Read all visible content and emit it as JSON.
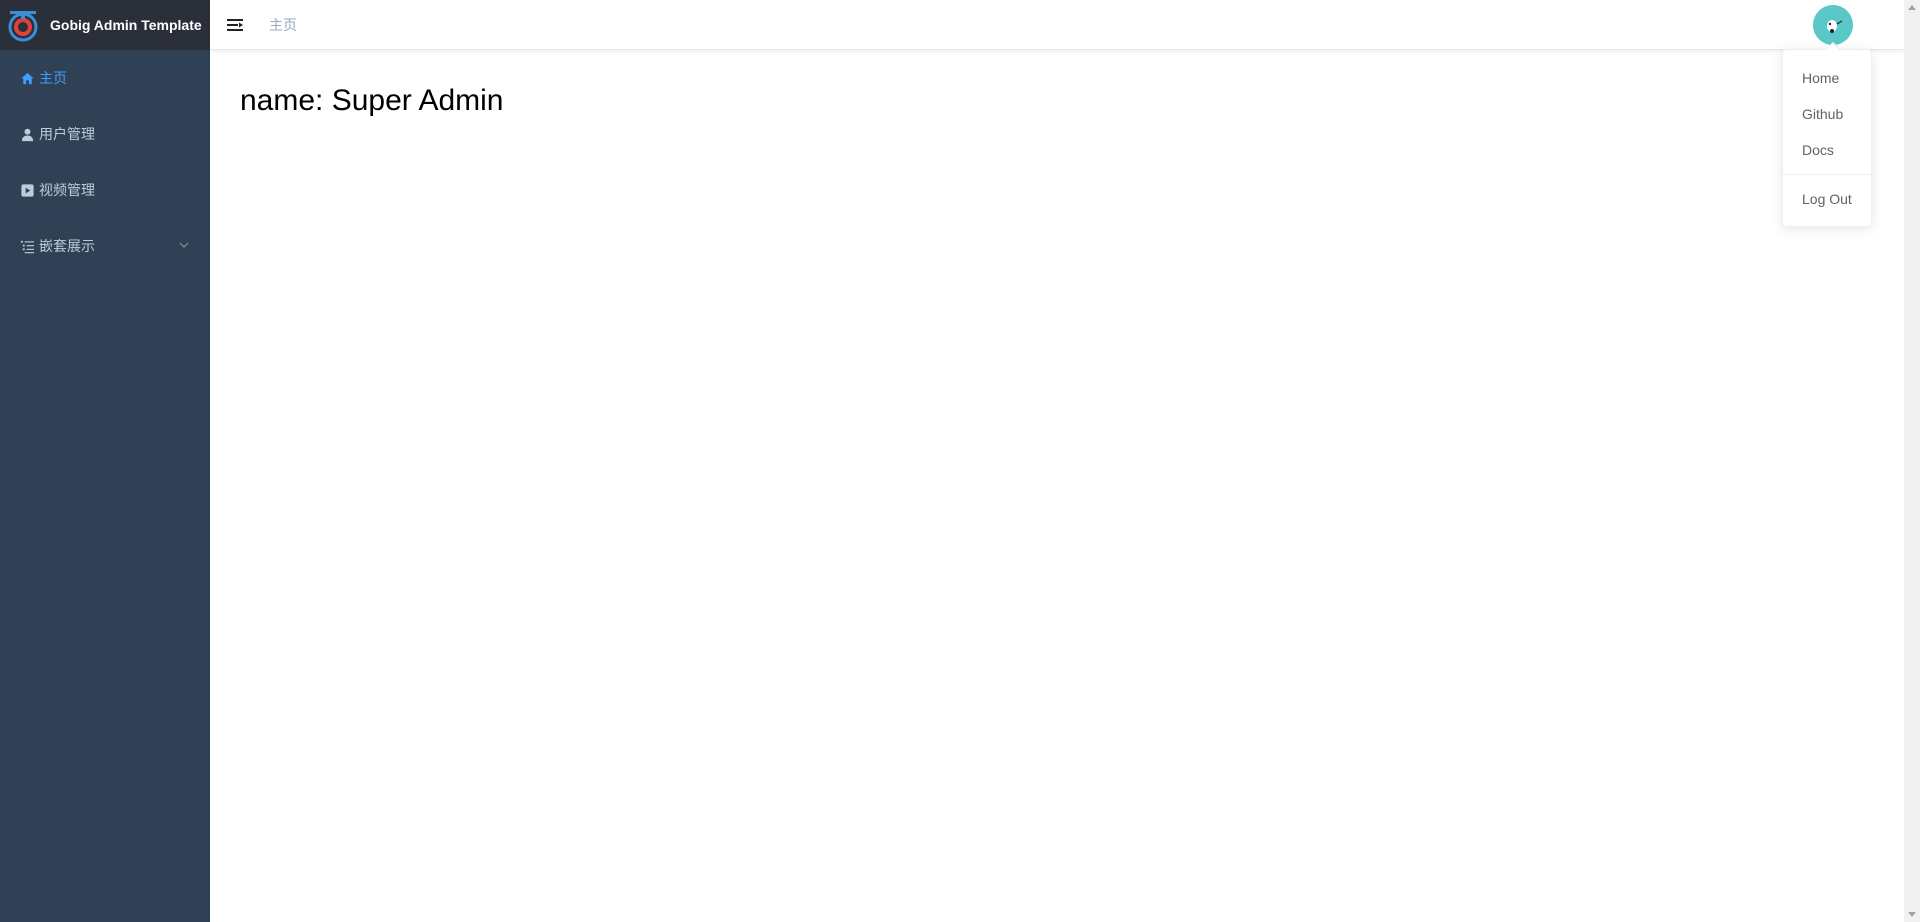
{
  "app": {
    "title": "Gobig Admin Template"
  },
  "sidebar": {
    "items": [
      {
        "label": "主页",
        "icon": "home-icon",
        "active": true
      },
      {
        "label": "用户管理",
        "icon": "user-icon",
        "active": false
      },
      {
        "label": "视频管理",
        "icon": "video-icon",
        "active": false
      },
      {
        "label": "嵌套展示",
        "icon": "list-icon",
        "active": false,
        "expandable": true
      }
    ]
  },
  "navbar": {
    "breadcrumb": "主页"
  },
  "main": {
    "name_line": "name: Super Admin"
  },
  "dropdown": {
    "items": [
      "Home",
      "Github",
      "Docs",
      "Log Out"
    ]
  },
  "colors": {
    "sidebar_bg": "#304156",
    "logo_bg": "#2b2f3a",
    "active": "#409eff",
    "menu_text": "#bfcbd9",
    "avatar_bg": "#5ac8c8"
  }
}
